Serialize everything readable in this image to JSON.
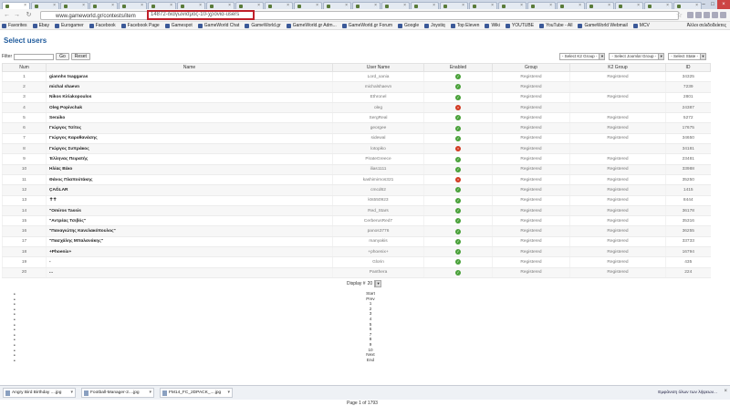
{
  "browser": {
    "tab_count": 24,
    "url": "www.gameworld.gr/contests/item",
    "url_highlight": "14872-διαγωνισμός-10-χρόνια-users",
    "bookmarks": [
      "Favorites",
      "Ebay",
      "Eurogamer",
      "Facebook",
      "Facebook Page",
      "Gamespot",
      "GameWorld Chat",
      "GameWorld.gr",
      "GameWorld.gr Adm...",
      "GameWorld.gr Forum",
      "Google",
      "Joystiq",
      "Top Eleven",
      "Wiki",
      "YOUTUBE",
      "YouTube - All",
      "GameWorld Webmail",
      "MCV"
    ],
    "bookmark_other": "Άλλοι σελιδοδείκτες"
  },
  "page": {
    "title": "Select users",
    "filter_label": "Filter",
    "filter_value": "",
    "go_label": "Go",
    "reset_label": "Reset",
    "select_k2_group": "- Select K2 Group -",
    "select_joomla_group": "- Select Joomla! Group -",
    "select_state": "- Select State -"
  },
  "table": {
    "headers": [
      "Num",
      "Name",
      "User Name",
      "Enabled",
      "Group",
      "K2 Group",
      "ID"
    ],
    "rows": [
      {
        "num": "1",
        "name": "giannhs tsaggaras",
        "username": "Lord_xania",
        "enabled": true,
        "group": "Registered",
        "k2group": "Registered",
        "id": "34325"
      },
      {
        "num": "2",
        "name": "michal shaevn",
        "username": "michalshaevn",
        "enabled": true,
        "group": "Registered",
        "k2group": "",
        "id": "7239"
      },
      {
        "num": "3",
        "name": "Nikos Kiriakopoulos",
        "username": "Ethronel",
        "enabled": true,
        "group": "Registered",
        "k2group": "Registered",
        "id": "2801"
      },
      {
        "num": "4",
        "name": "Oleg Popivchak",
        "username": "oleg",
        "enabled": false,
        "group": "Registered",
        "k2group": "",
        "id": "24387"
      },
      {
        "num": "5",
        "name": "Seraiko",
        "username": "SergReal",
        "enabled": true,
        "group": "Registered",
        "k2group": "Registered",
        "id": "5272"
      },
      {
        "num": "6",
        "name": "Γιώργος Τσίτος",
        "username": "georgee",
        "enabled": true,
        "group": "Registered",
        "k2group": "Registered",
        "id": "17675"
      },
      {
        "num": "7",
        "name": "Γιώργος Καραθανάσης",
        "username": "sidewal",
        "enabled": true,
        "group": "Registered",
        "k2group": "Registered",
        "id": "34650"
      },
      {
        "num": "8",
        "name": "Γιώργος Συπράκος",
        "username": "lotopiko",
        "enabled": false,
        "group": "Registered",
        "k2group": "",
        "id": "34181"
      },
      {
        "num": "9",
        "name": "Έλληνας Πειρατής",
        "username": "PirateGreece",
        "enabled": true,
        "group": "Registered",
        "k2group": "Registered",
        "id": "23481"
      },
      {
        "num": "10",
        "name": "Ηλίας Βέκο",
        "username": "ilias1111",
        "enabled": true,
        "group": "Registered",
        "k2group": "Registered",
        "id": "33988"
      },
      {
        "num": "11",
        "name": "Θάνος Πλαπούτάκης",
        "username": "kashimirnos321",
        "enabled": false,
        "group": "Registered",
        "k2group": "Registered",
        "id": "35250"
      },
      {
        "num": "12",
        "name": "ÇAĞLAR",
        "username": "cmcd62",
        "enabled": true,
        "group": "Registered",
        "k2group": "Registered",
        "id": "1415"
      },
      {
        "num": "13",
        "name": "✝✝",
        "username": "kts550923",
        "enabled": true,
        "group": "Registered",
        "k2group": "Registered",
        "id": "8444"
      },
      {
        "num": "14",
        "name": "\"Omiros Tassis",
        "username": "Red_Stars",
        "enabled": true,
        "group": "Registered",
        "k2group": "Registered",
        "id": "36178"
      },
      {
        "num": "15",
        "name": "\"Αντρέας Τσιβός\"",
        "username": "CerberusRed7",
        "enabled": true,
        "group": "Registered",
        "k2group": "Registered",
        "id": "35316"
      },
      {
        "num": "16",
        "name": "\"Παναγιώτης Κανελακόπουλος\"",
        "username": "panos3776",
        "enabled": true,
        "group": "Registered",
        "k2group": "Registered",
        "id": "36255"
      },
      {
        "num": "17",
        "name": "\"Πασχάλης Μπαλανάκης\"",
        "username": "manyakis",
        "enabled": true,
        "group": "Registered",
        "k2group": "Registered",
        "id": "33733"
      },
      {
        "num": "18",
        "name": "+Phoenix+",
        "username": "+phoenix+",
        "enabled": true,
        "group": "Registered",
        "k2group": "Registered",
        "id": "16794"
      },
      {
        "num": "19",
        "name": "-",
        "username": "Glorin",
        "enabled": true,
        "group": "Registered",
        "k2group": "Registered",
        "id": "435"
      },
      {
        "num": "20",
        "name": "...",
        "username": "Panthera",
        "enabled": true,
        "group": "Registered",
        "k2group": "Registered",
        "id": "224"
      }
    ]
  },
  "pagination": {
    "display_label": "Display #",
    "display_value": "20",
    "items": [
      "Start",
      "Prev",
      "1",
      "2",
      "3",
      "4",
      "5",
      "6",
      "7",
      "8",
      "9",
      "10",
      "Next",
      "End"
    ],
    "page_of": "Page 1 of 1793"
  },
  "downloads": {
    "files": [
      "Angry Bird Birthday ....jpg",
      "Football-Manager-2....jpg",
      "FM14_FC_2DPACK_....jpg"
    ],
    "show_all": "Εμφάνιση όλων των λήψεων..."
  }
}
